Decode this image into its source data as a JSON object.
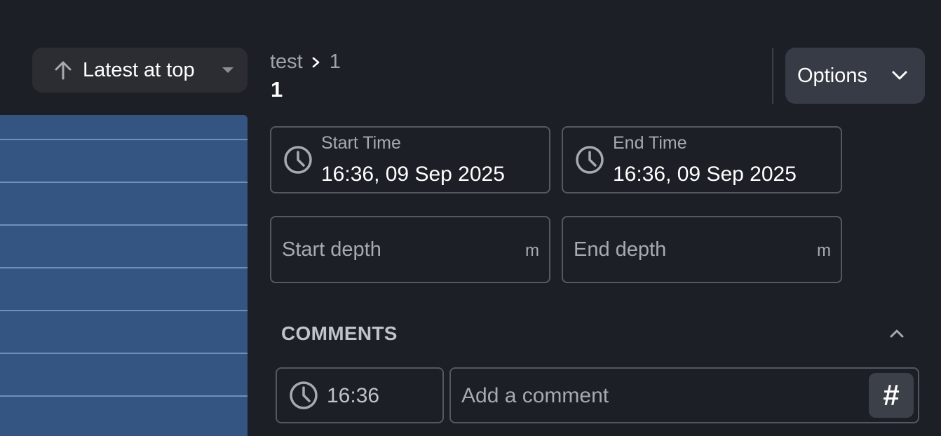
{
  "sort": {
    "label": "Latest at top",
    "icon": "arrow-up-icon"
  },
  "breadcrumb": {
    "parent": "test",
    "current": "1"
  },
  "title": "1",
  "options": {
    "label": "Options"
  },
  "start_time": {
    "label": "Start Time",
    "value": "16:36, 09 Sep 2025"
  },
  "end_time": {
    "label": "End Time",
    "value": "16:36, 09 Sep 2025"
  },
  "start_depth": {
    "placeholder": "Start depth",
    "unit": "m"
  },
  "end_depth": {
    "placeholder": "End depth",
    "unit": "m"
  },
  "comments": {
    "heading": "COMMENTS",
    "time": "16:36",
    "placeholder": "Add a comment",
    "hash_label": "#"
  },
  "colors": {
    "background": "#1c1f26",
    "panel": "#345482",
    "button": "#373b45"
  }
}
